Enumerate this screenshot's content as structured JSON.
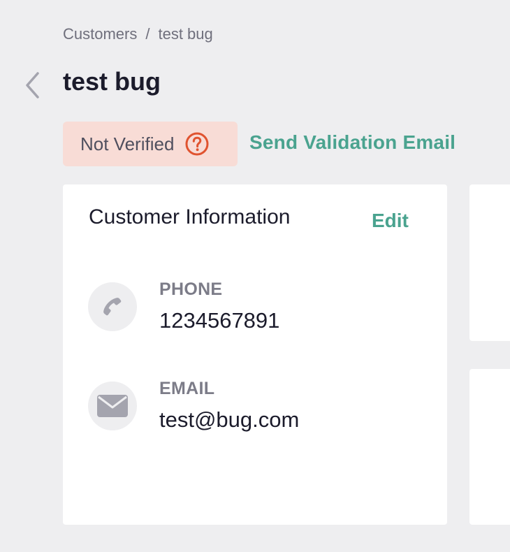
{
  "breadcrumb": {
    "items": [
      "Customers",
      "test bug"
    ],
    "separator": "/"
  },
  "page": {
    "title": "test bug"
  },
  "verification": {
    "status": "Not Verified",
    "action": "Send Validation Email"
  },
  "customer_info": {
    "title": "Customer Information",
    "edit_label": "Edit",
    "phone": {
      "label": "PHONE",
      "value": "1234567891"
    },
    "email": {
      "label": "EMAIL",
      "value": "test@bug.com"
    }
  },
  "colors": {
    "accent": "#4aa38f",
    "warning": "#e0532f",
    "warning_bg": "#f8dcd6",
    "background": "#eeeef0"
  }
}
